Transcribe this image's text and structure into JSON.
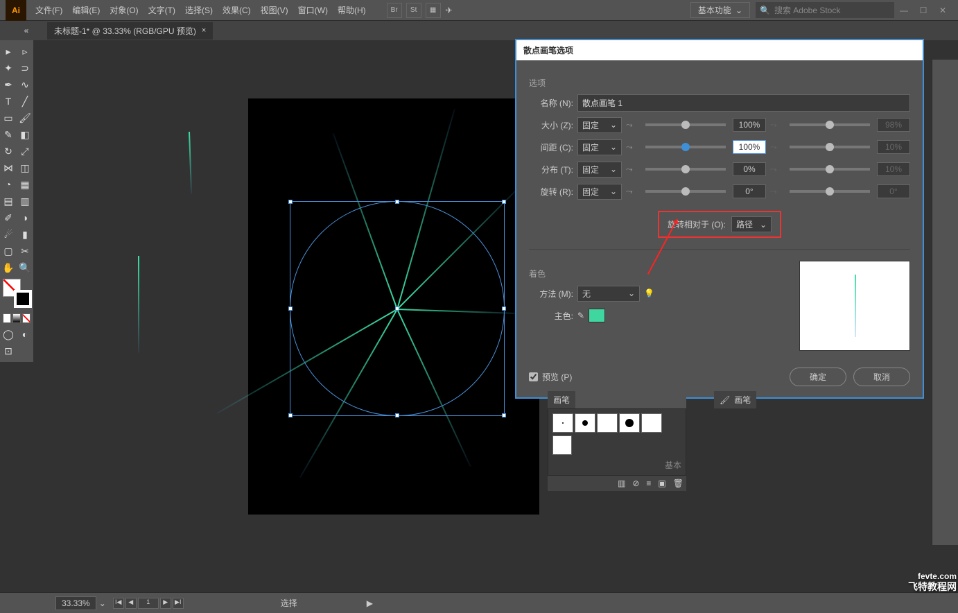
{
  "app": {
    "logo": "Ai"
  },
  "menu": {
    "file": "文件(F)",
    "edit": "编辑(E)",
    "object": "对象(O)",
    "text": "文字(T)",
    "select": "选择(S)",
    "effect": "效果(C)",
    "view": "视图(V)",
    "window": "窗口(W)",
    "help": "帮助(H)"
  },
  "header": {
    "bridge": "Br",
    "stock": "St",
    "workspace": "基本功能",
    "search_placeholder": "搜索 Adobe Stock"
  },
  "tab": {
    "title": "未标题-1* @ 33.33% (RGB/GPU 预览)",
    "close": "×"
  },
  "dialog": {
    "title": "散点画笔选项",
    "options_label": "选项",
    "name_label": "名称 (N):",
    "name_value": "散点画笔 1",
    "size_label": "大小 (Z):",
    "size_mode": "固定",
    "size_val": "100%",
    "size_val2": "98%",
    "spacing_label": "间距 (C):",
    "spacing_mode": "固定",
    "spacing_val": "100%",
    "spacing_val2": "10%",
    "scatter_label": "分布 (T):",
    "scatter_mode": "固定",
    "scatter_val": "0%",
    "scatter_val2": "10%",
    "rotation_label": "旋转 (R):",
    "rotation_mode": "固定",
    "rotation_val": "0°",
    "rotation_val2": "0°",
    "rotate_relative": "旋转相对于 (O):",
    "rotate_value": "路径",
    "colorization": "着色",
    "method_label": "方法 (M):",
    "method_value": "无",
    "keycolor_label": "主色:",
    "preview_label": "预览 (P)",
    "ok": "确定",
    "cancel": "取消",
    "dropdown_caret": "⌄"
  },
  "brushes": {
    "label": "画笔",
    "basic": "基本"
  },
  "status": {
    "zoom": "33.33%",
    "page": "1",
    "tool": "选择",
    "nav": {
      "first": "I◀",
      "prev": "◀",
      "next": "▶",
      "last": "▶I"
    }
  },
  "watermark": {
    "url": "fevte.com",
    "text": "飞特教程网"
  },
  "icons": {
    "search": "🔍",
    "caret": "⌄",
    "eyedropper": "✎",
    "lamp": "💡",
    "checkmark": "✓"
  }
}
